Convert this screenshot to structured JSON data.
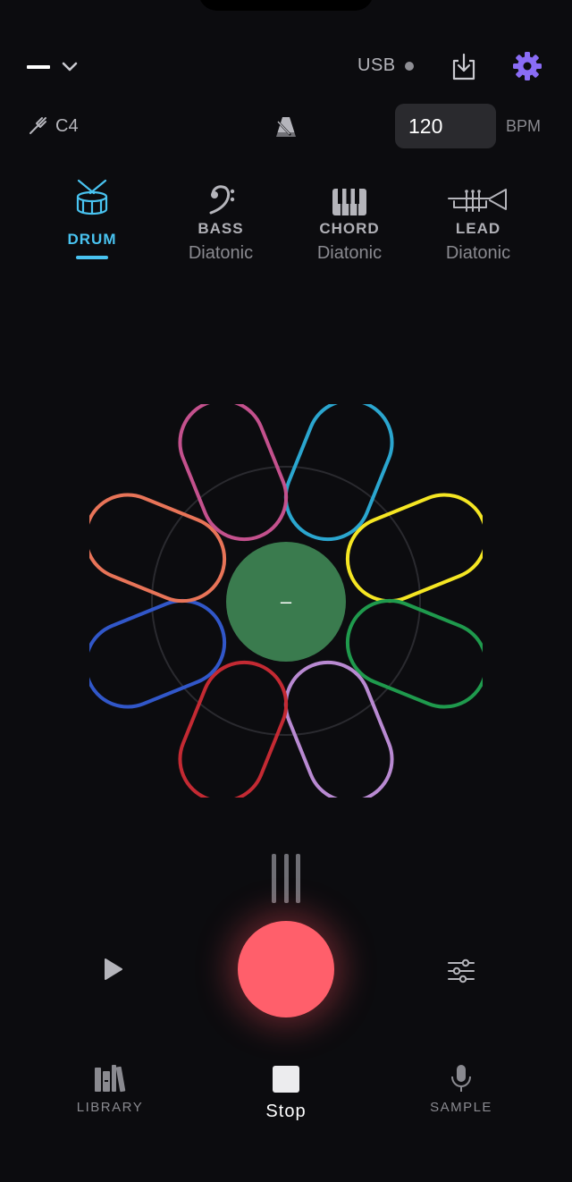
{
  "top_bar": {
    "menu_icon": "dash-icon",
    "dropdown_icon": "chevron-down-icon",
    "usb_label": "USB",
    "usb_status_color": "#8e8e94",
    "export_icon": "download-tray-icon",
    "settings_icon": "gear-icon",
    "settings_color": "#8a6cf5"
  },
  "tuning": {
    "icon": "tuning-fork-icon",
    "key": "C4"
  },
  "metronome_icon": "metronome-icon",
  "tempo": {
    "value": "120",
    "unit": "BPM"
  },
  "instruments": [
    {
      "name": "DRUM",
      "subtitle": "",
      "icon": "drum-icon",
      "active": true
    },
    {
      "name": "BASS",
      "subtitle": "Diatonic",
      "icon": "bass-clef-icon",
      "active": false
    },
    {
      "name": "CHORD",
      "subtitle": "Diatonic",
      "icon": "piano-keys-icon",
      "active": false
    },
    {
      "name": "LEAD",
      "subtitle": "Diatonic",
      "icon": "trumpet-icon",
      "active": false
    }
  ],
  "accent_color": "#49c3f0",
  "pad_wheel": {
    "center_label": "–",
    "center_color": "#3a7b4e",
    "pad_colors": [
      "#d9a832",
      "#2ba6cf",
      "#f5e623",
      "#1f9a4d",
      "#b98ad2",
      "#c42a33",
      "#3157c9",
      "#e87458",
      "#c4518d"
    ]
  },
  "transport": {
    "play_icon": "play-icon",
    "record_color": "#ff5f6b",
    "mixer_icon": "sliders-icon"
  },
  "bottom_nav": {
    "library": {
      "label": "LIBRARY",
      "icon": "books-icon"
    },
    "stop": {
      "label": "Stop",
      "icon": "stop-square-icon"
    },
    "sample": {
      "label": "SAMPLE",
      "icon": "microphone-icon"
    }
  }
}
